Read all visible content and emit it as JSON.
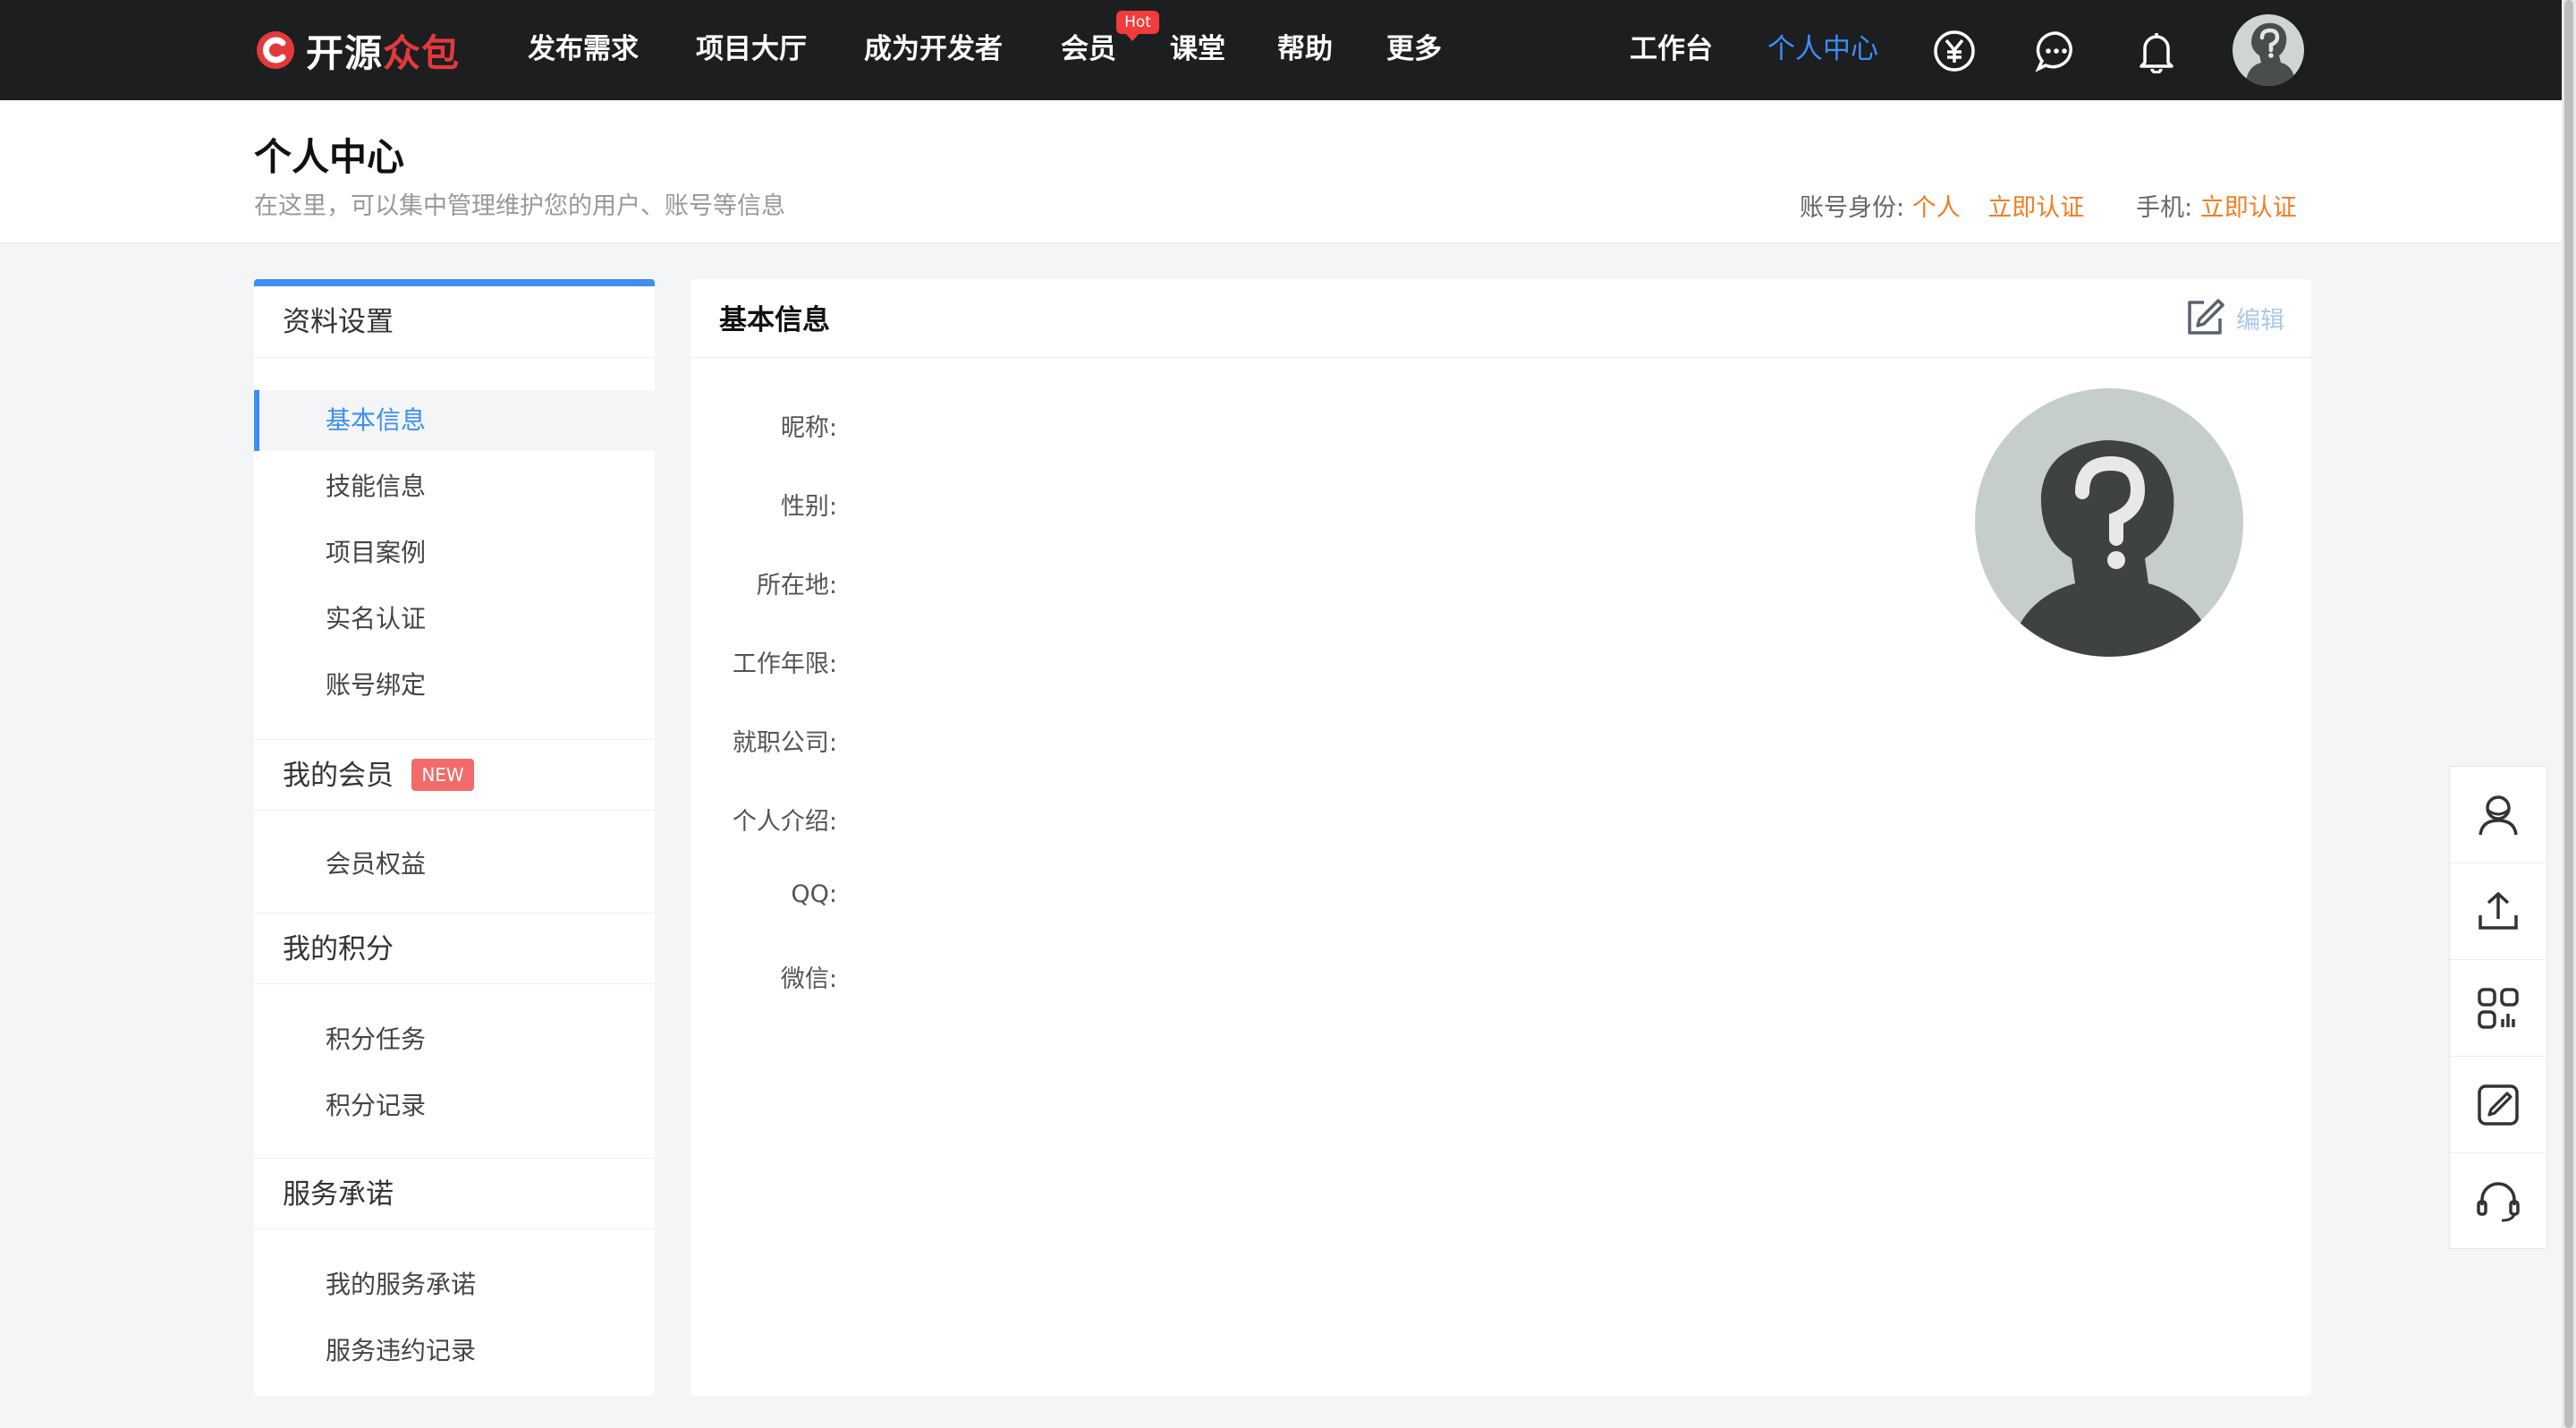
{
  "nav": {
    "logo_prefix": "开源",
    "logo_suffix": "众包",
    "items": [
      "发布需求",
      "项目大厅",
      "成为开发者",
      "会员",
      "课堂",
      "帮助",
      "更多"
    ],
    "hot_badge": "Hot",
    "workbench": "工作台",
    "personal_center": "个人中心",
    "icons": [
      "yuan-icon",
      "message-icon",
      "bell-icon",
      "avatar"
    ]
  },
  "header": {
    "title": "个人中心",
    "subtitle": "在这里，可以集中管理维护您的用户、账号等信息",
    "identity_label": "账号身份:",
    "identity_value": "个人",
    "identity_action": "立即认证",
    "phone_label": "手机:",
    "phone_action": "立即认证"
  },
  "sidebar": {
    "groups": [
      {
        "title": "资料设置",
        "items": [
          "基本信息",
          "技能信息",
          "项目案例",
          "实名认证",
          "账号绑定"
        ]
      },
      {
        "title": "我的会员",
        "badge": "NEW",
        "items": [
          "会员权益"
        ]
      },
      {
        "title": "我的积分",
        "items": [
          "积分任务",
          "积分记录"
        ]
      },
      {
        "title": "服务承诺",
        "items": [
          "我的服务承诺",
          "服务违约记录"
        ]
      }
    ],
    "active_item": "基本信息"
  },
  "card": {
    "title": "基本信息",
    "edit_label": "编辑",
    "fields": [
      "昵称:",
      "性别:",
      "所在地:",
      "工作年限:",
      "就职公司:",
      "个人介绍:",
      "QQ:",
      "微信:"
    ]
  },
  "float_bar": [
    "user-icon",
    "upload-icon",
    "apps-icon",
    "edit-icon",
    "headset-icon"
  ],
  "colors": {
    "accent": "#3d8ef5",
    "brand_red": "#e4393c",
    "orange": "#f57c22",
    "nav_bg": "#1d1e20"
  }
}
